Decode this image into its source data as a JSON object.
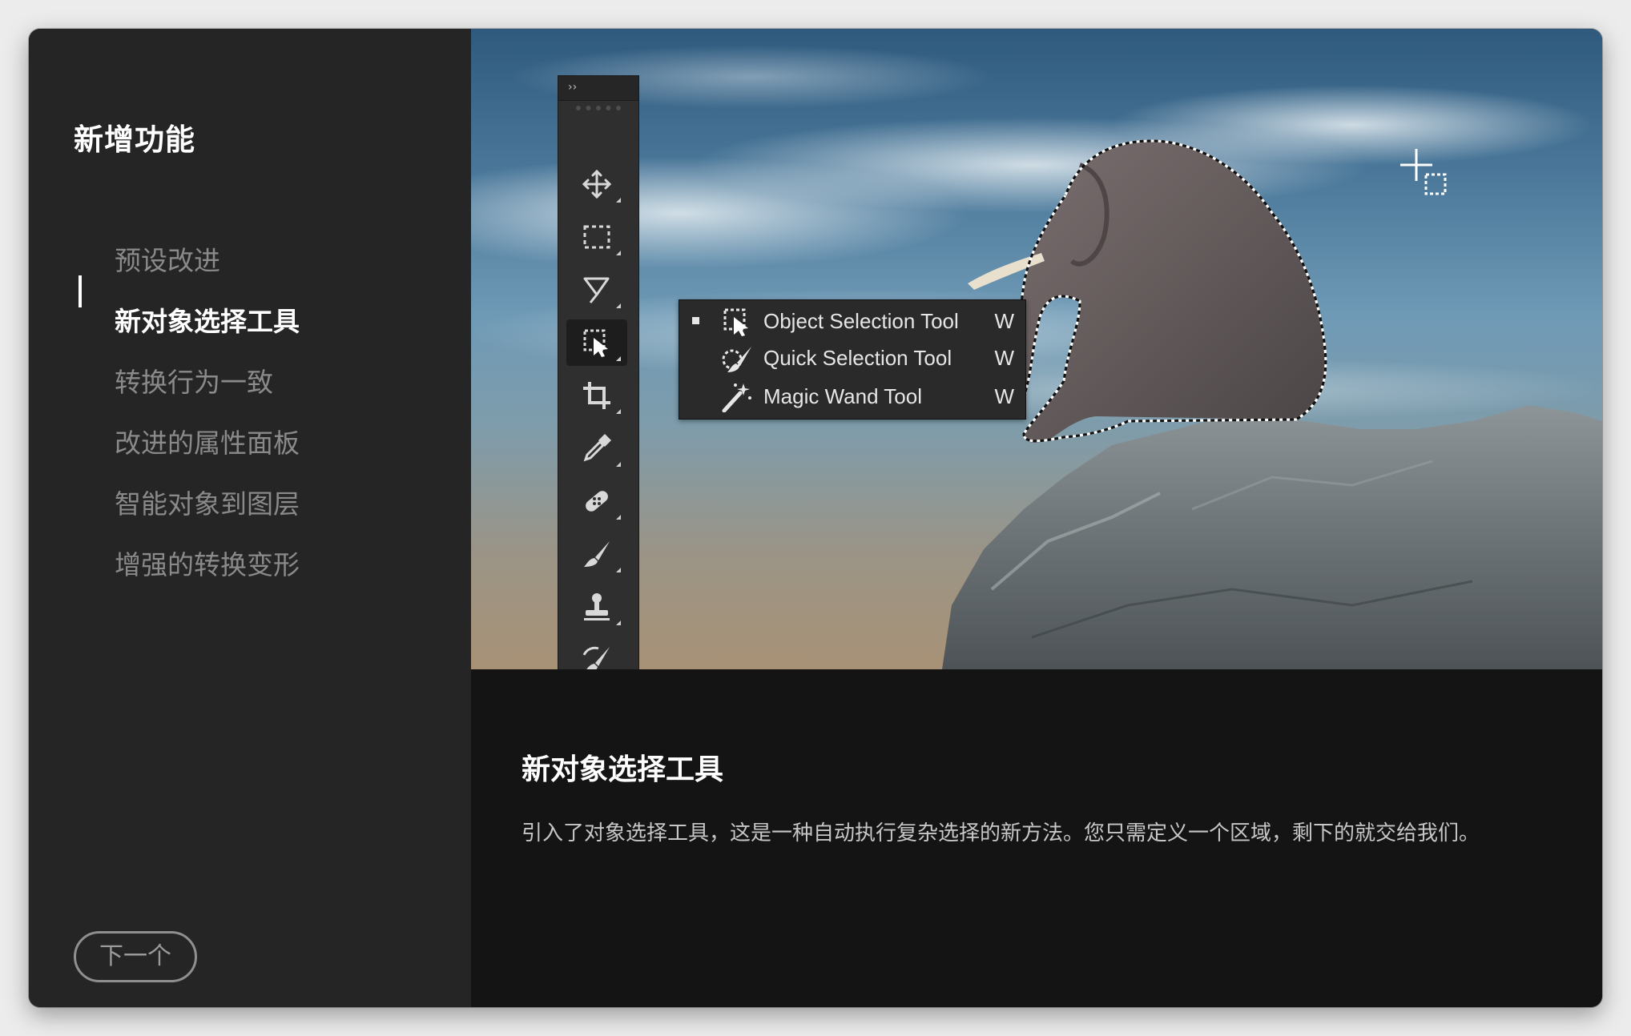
{
  "sidebar": {
    "title": "新增功能",
    "items": [
      {
        "label": "预设改进",
        "active": false
      },
      {
        "label": "新对象选择工具",
        "active": true
      },
      {
        "label": "转换行为一致",
        "active": false
      },
      {
        "label": "改进的属性面板",
        "active": false
      },
      {
        "label": "智能对象到图层",
        "active": false
      },
      {
        "label": "增强的转换变形",
        "active": false
      }
    ],
    "next_button": "下一个"
  },
  "toolbar": {
    "collapse_glyph": "››",
    "tools": [
      {
        "icon": "move-tool-icon"
      },
      {
        "icon": "rectangular-marquee-tool-icon"
      },
      {
        "icon": "lasso-tool-icon"
      },
      {
        "icon": "object-selection-tool-icon",
        "active": true
      },
      {
        "icon": "crop-tool-icon"
      },
      {
        "icon": "eyedropper-tool-icon"
      },
      {
        "icon": "healing-brush-tool-icon"
      },
      {
        "icon": "brush-tool-icon"
      },
      {
        "icon": "clone-stamp-tool-icon"
      },
      {
        "icon": "history-brush-tool-icon"
      }
    ]
  },
  "flyout": {
    "items": [
      {
        "label": "Object Selection Tool",
        "shortcut": "W",
        "icon": "object-selection-tool-icon",
        "selected": true
      },
      {
        "label": "Quick Selection Tool",
        "shortcut": "W",
        "icon": "quick-selection-tool-icon",
        "selected": false
      },
      {
        "label": "Magic Wand Tool",
        "shortcut": "W",
        "icon": "magic-wand-tool-icon",
        "selected": false
      }
    ]
  },
  "description": {
    "title": "新对象选择工具",
    "body": "引入了对象选择工具，这是一种自动执行复杂选择的新方法。您只需定义一个区域，剩下的就交给我们。"
  },
  "colors": {
    "sidebar_bg": "#252525",
    "description_bg": "#141414",
    "active_text": "#ffffff",
    "inactive_text": "#8a8a8a"
  }
}
